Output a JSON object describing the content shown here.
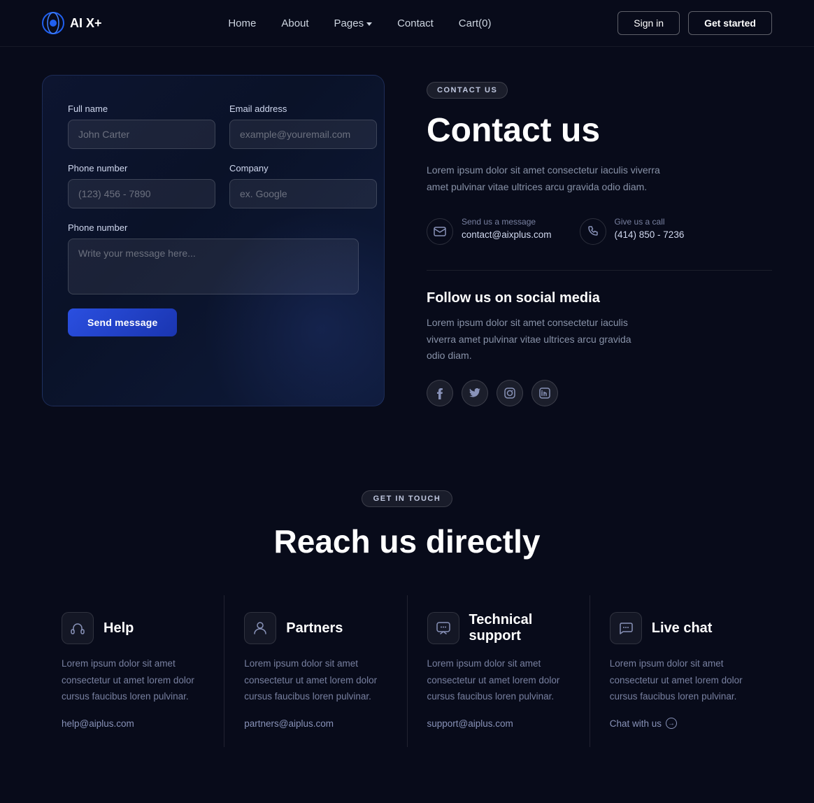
{
  "navbar": {
    "logo_text": "AI X+",
    "links": [
      {
        "label": "Home",
        "id": "home"
      },
      {
        "label": "About",
        "id": "about"
      },
      {
        "label": "Pages",
        "id": "pages",
        "has_dropdown": true
      },
      {
        "label": "Contact",
        "id": "contact"
      },
      {
        "label": "Cart(0)",
        "id": "cart"
      }
    ],
    "sign_in": "Sign in",
    "get_started": "Get started"
  },
  "form": {
    "full_name_label": "Full name",
    "full_name_placeholder": "John Carter",
    "email_label": "Email address",
    "email_placeholder": "example@youremail.com",
    "phone_label": "Phone number",
    "phone_placeholder": "(123) 456 - 7890",
    "company_label": "Company",
    "company_placeholder": "ex. Google",
    "message_label": "Phone number",
    "message_placeholder": "Write your message here...",
    "send_button": "Send message"
  },
  "contact_info": {
    "badge": "CONTACT US",
    "title": "Contact us",
    "description": "Lorem ipsum dolor sit amet consectetur iaculis viverra amet pulvinar vitae ultrices arcu gravida odio diam.",
    "email_label": "Send us a message",
    "email_value": "contact@aixplus.com",
    "phone_label": "Give us a call",
    "phone_value": "(414) 850 - 7236",
    "social_title": "Follow us on social media",
    "social_desc": "Lorem ipsum dolor sit amet consectetur iaculis viverra amet pulvinar vitae ultrices arcu gravida odio diam.",
    "social": [
      {
        "icon": "f",
        "name": "facebook"
      },
      {
        "icon": "t",
        "name": "twitter"
      },
      {
        "icon": "i",
        "name": "instagram"
      },
      {
        "icon": "in",
        "name": "linkedin"
      }
    ]
  },
  "lower_section": {
    "badge": "GET IN TOUCH",
    "title": "Reach us directly",
    "cards": [
      {
        "id": "help",
        "icon": "🎧",
        "title": "Help",
        "description": "Lorem ipsum dolor sit amet consectetur ut amet lorem dolor cursus faucibus loren pulvinar.",
        "link": "help@aiplus.com",
        "link_type": "email"
      },
      {
        "id": "partners",
        "icon": "👤",
        "title": "Partners",
        "description": "Lorem ipsum dolor sit amet consectetur ut amet lorem dolor cursus faucibus loren pulvinar.",
        "link": "partners@aiplus.com",
        "link_type": "email"
      },
      {
        "id": "technical-support",
        "icon": "💬",
        "title": "Technical support",
        "description": "Lorem ipsum dolor sit amet consectetur ut amet lorem dolor cursus faucibus loren pulvinar.",
        "link": "support@aiplus.com",
        "link_type": "email"
      },
      {
        "id": "live-chat",
        "icon": "💭",
        "title": "Live chat",
        "description": "Lorem ipsum dolor sit amet consectetur ut amet lorem dolor cursus faucibus loren pulvinar.",
        "link": "Chat with us",
        "link_type": "arrow"
      }
    ]
  }
}
